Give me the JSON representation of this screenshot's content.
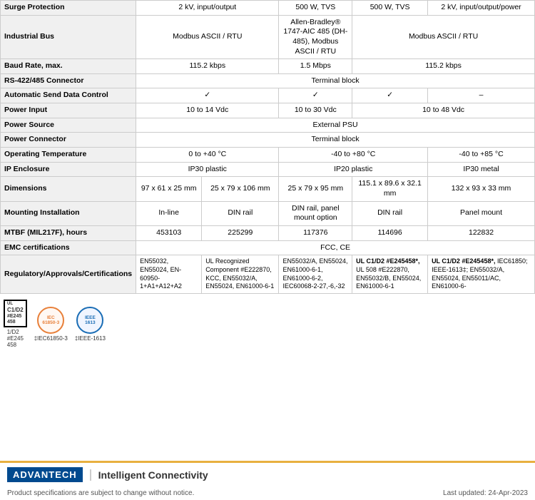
{
  "table": {
    "columns": [
      "col1",
      "col2",
      "col3",
      "col4",
      "col5"
    ],
    "rows": [
      {
        "label": "Surge Protection",
        "cells": [
          "2 kV, input/output",
          "500 W, TVS",
          "500 W, TVS",
          "2 kV, input/output/power",
          ""
        ]
      },
      {
        "label": "Industrial Bus",
        "cells": [
          "Modbus ASCII / RTU",
          "",
          "Allen-Bradley® 1747-AIC 485 (DH-485), Modbus ASCII / RTU",
          "Modbus ASCII / RTU",
          ""
        ]
      },
      {
        "label": "Baud Rate, max.",
        "cells": [
          "115.2 kbps",
          "1.5 Mbps",
          "",
          "115.2 kbps",
          ""
        ]
      },
      {
        "label": "RS-422/485 Connector",
        "cells": [
          "Terminal block",
          "",
          "",
          "",
          ""
        ]
      },
      {
        "label": "Automatic Send Data Control",
        "cells": [
          "✓",
          "✓",
          "✓",
          "–",
          ""
        ]
      },
      {
        "label": "Power Input",
        "cells": [
          "10 to 14  Vdc",
          "10 to 30 Vdc",
          "",
          "10 to 48 Vdc",
          ""
        ]
      },
      {
        "label": "Power Source",
        "cells": [
          "External PSU",
          "",
          "",
          "",
          ""
        ]
      },
      {
        "label": "Power Connector",
        "cells": [
          "Terminal block",
          "",
          "",
          "",
          ""
        ]
      },
      {
        "label": "Operating Temperature",
        "cells": [
          "0 to +40 °C",
          "-40 to +80 °C",
          "",
          "-40 to +85 °C",
          ""
        ]
      },
      {
        "label": "IP Enclosure",
        "cells": [
          "IP30 plastic",
          "IP20 plastic",
          "",
          "IP30 metal",
          ""
        ]
      },
      {
        "label": "Dimensions",
        "cells": [
          "97 x 61 x 25 mm",
          "25 x 79 x 106 mm",
          "25 x 79 x 95 mm",
          "115.1 x 89.6 x 32.1 mm",
          "132 x 93 x 33 mm"
        ]
      },
      {
        "label": "Mounting Installation",
        "cells": [
          "In-line",
          "DIN rail",
          "DIN rail, panel mount option",
          "DIN rail",
          "Panel mount"
        ]
      },
      {
        "label": "MTBF (MIL217F), hours",
        "cells": [
          "453103",
          "225299",
          "117376",
          "114696",
          "122832"
        ]
      },
      {
        "label": "EMC certifications",
        "cells": [
          "",
          "FCC, CE",
          "",
          "",
          ""
        ]
      },
      {
        "label": "Regulatory/Approvals/Certifications",
        "cells": [
          "EN55032, EN55024, EN-60950-1+A1+A12+A2",
          "UL Recognized Component #E222870, KCC, EN55032/A, EN55024, EN61000-6-1",
          "EN55032/A, EN55024, EN61000-6-1, EN61000-6-2, IEC60068-2-27,-6,-32",
          "UL C1/D2 #E245458*, UL 508 #E222870, EN55032/B, EN55024, EN61000-6-1",
          "UL C1/D2 #E245458*, IEC61850; IEEE-1613‡; EN55032/A, EN55024, EN55011/AC, EN61000-6-"
        ]
      }
    ]
  },
  "cert_icons": [
    {
      "id": "c1",
      "label": "UL\nC1/D2\n#E245\n458",
      "sub": ""
    },
    {
      "id": "c2",
      "label": "IEC61850-3",
      "sub": "‡IEC61850-3"
    },
    {
      "id": "c3",
      "label": "IEEE-1613",
      "sub": "‡IEEE-1613"
    }
  ],
  "footer": {
    "logo_text": "ADVANTECH",
    "tagline": "Intelligent Connectivity",
    "disclaimer": "Product specifications are subject to change without notice.",
    "updated": "Last updated: 24-Apr-2023"
  }
}
